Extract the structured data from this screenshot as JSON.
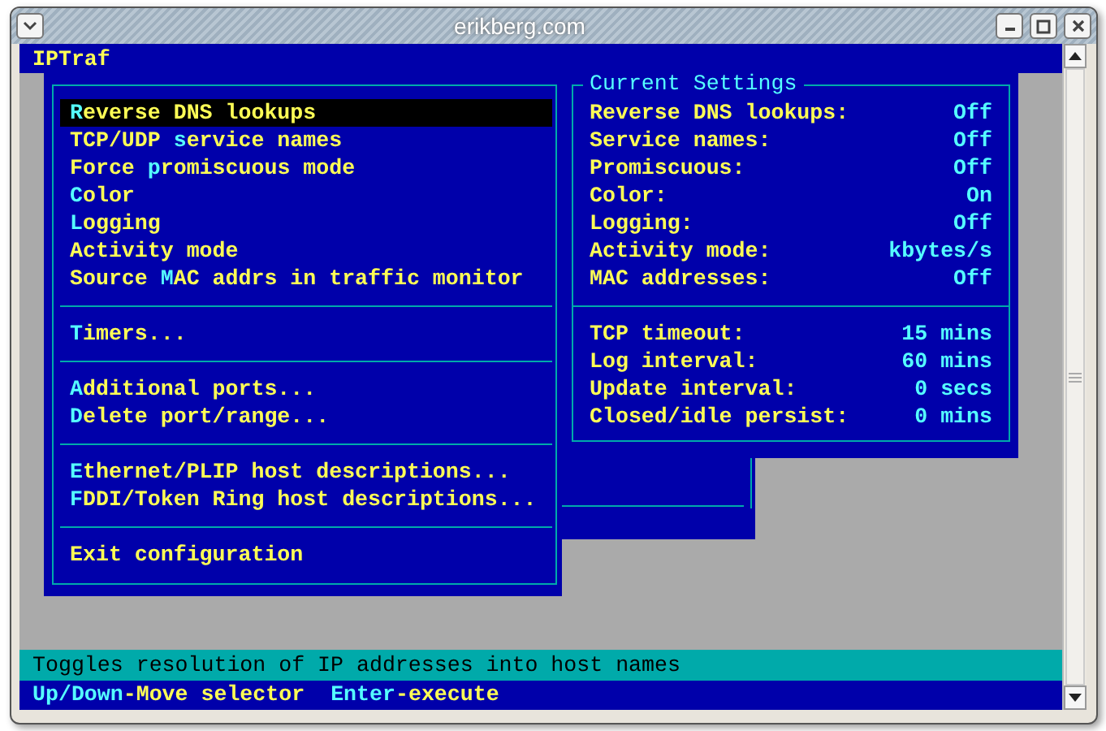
{
  "window": {
    "title": "erikberg.com"
  },
  "app": {
    "title": "IPTraf"
  },
  "menu": {
    "groups": [
      {
        "items": [
          {
            "label": [
              {
                "text": "R",
                "hotkey": true
              },
              {
                "text": "everse DNS lookups",
                "hotkey": false
              }
            ],
            "selected": true
          },
          {
            "label": [
              {
                "text": "TCP/UDP ",
                "hotkey": false
              },
              {
                "text": "s",
                "hotkey": true
              },
              {
                "text": "ervice names",
                "hotkey": false
              }
            ],
            "selected": false
          },
          {
            "label": [
              {
                "text": "Force ",
                "hotkey": false
              },
              {
                "text": "p",
                "hotkey": true
              },
              {
                "text": "romiscuous mode",
                "hotkey": false
              }
            ],
            "selected": false
          },
          {
            "label": [
              {
                "text": "C",
                "hotkey": true
              },
              {
                "text": "olor",
                "hotkey": false
              }
            ],
            "selected": false
          },
          {
            "label": [
              {
                "text": "L",
                "hotkey": true
              },
              {
                "text": "ogging",
                "hotkey": false
              }
            ],
            "selected": false
          },
          {
            "label": [
              {
                "text": "Activity mode",
                "hotkey": false
              }
            ],
            "selected": false
          },
          {
            "label": [
              {
                "text": "Source ",
                "hotkey": false
              },
              {
                "text": "M",
                "hotkey": true
              },
              {
                "text": "AC addrs in traffic monitor",
                "hotkey": false
              }
            ],
            "selected": false
          }
        ]
      },
      {
        "items": [
          {
            "label": [
              {
                "text": "T",
                "hotkey": true
              },
              {
                "text": "imers...",
                "hotkey": false
              }
            ],
            "selected": false
          }
        ]
      },
      {
        "items": [
          {
            "label": [
              {
                "text": "A",
                "hotkey": true
              },
              {
                "text": "dditional ports...",
                "hotkey": false
              }
            ],
            "selected": false
          },
          {
            "label": [
              {
                "text": "D",
                "hotkey": true
              },
              {
                "text": "elete port/range...",
                "hotkey": false
              }
            ],
            "selected": false
          }
        ]
      },
      {
        "items": [
          {
            "label": [
              {
                "text": "E",
                "hotkey": true
              },
              {
                "text": "thernet/PLIP host descriptions...",
                "hotkey": false
              }
            ],
            "selected": false
          },
          {
            "label": [
              {
                "text": "F",
                "hotkey": true
              },
              {
                "text": "DDI/Token Ring host descriptions...",
                "hotkey": false
              }
            ],
            "selected": false
          }
        ]
      },
      {
        "items": [
          {
            "label": [
              {
                "text": "Exit configuration",
                "hotkey": false
              }
            ],
            "selected": false
          }
        ]
      }
    ]
  },
  "current_settings": {
    "title": "Current Settings",
    "groups": [
      {
        "rows": [
          {
            "label": "Reverse DNS lookups:",
            "value": "Off"
          },
          {
            "label": "Service names:",
            "value": "Off"
          },
          {
            "label": "Promiscuous:",
            "value": "Off"
          },
          {
            "label": "Color:",
            "value": "On"
          },
          {
            "label": "Logging:",
            "value": "Off"
          },
          {
            "label": "Activity mode:",
            "value": "kbytes/s"
          },
          {
            "label": "MAC addresses:",
            "value": "Off"
          }
        ]
      },
      {
        "rows": [
          {
            "label": "TCP timeout:",
            "value": "15 mins"
          },
          {
            "label": "Log interval:",
            "value": "60 mins"
          },
          {
            "label": "Update interval:",
            "value": "0 secs"
          },
          {
            "label": "Closed/idle persist:",
            "value": "0 mins"
          }
        ]
      }
    ]
  },
  "status_bar": {
    "text": "Toggles resolution of IP addresses into host names"
  },
  "key_hints": [
    {
      "key": "Up/Down",
      "action": "-Move selector"
    },
    {
      "key": "Enter",
      "action": "-execute"
    }
  ]
}
